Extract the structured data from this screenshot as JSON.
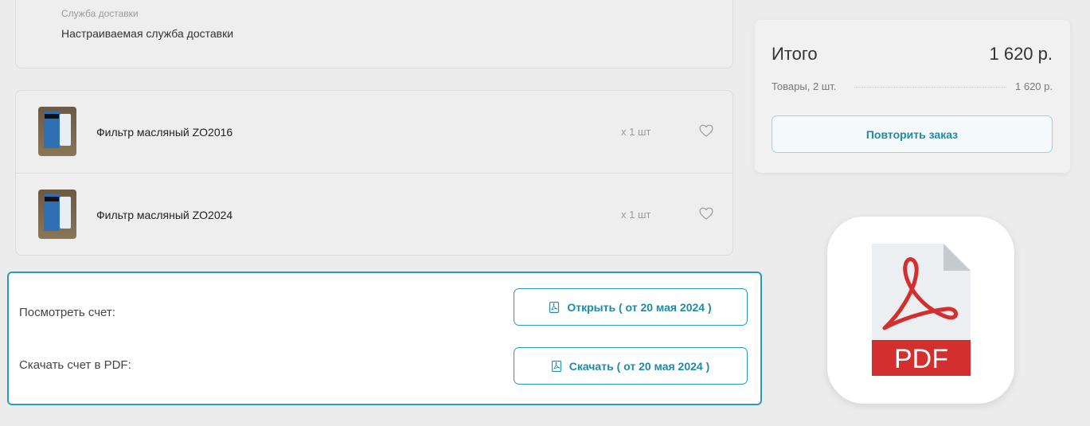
{
  "delivery": {
    "label": "Служба доставки",
    "value": "Настраиваемая служба доставки"
  },
  "items": [
    {
      "name": "Фильтр масляный ZO2016",
      "qty": "x 1 шт"
    },
    {
      "name": "Фильтр масляный ZO2024",
      "qty": "x 1 шт"
    }
  ],
  "invoice": {
    "view_label": "Посмотреть счет:",
    "open_button": "Открыть ( от 20 мая 2024 )",
    "download_label": "Скачать счет в PDF:",
    "download_button": "Скачать ( от 20 мая 2024 )"
  },
  "total": {
    "title": "Итого",
    "sum": "1 620 р.",
    "goods_label": "Товары, 2 шт.",
    "goods_sum": "1 620 р.",
    "repeat_button": "Повторить заказ"
  },
  "pdf_icon": {
    "text": "PDF",
    "icon": "pdf-file-icon"
  },
  "colors": {
    "accent": "#2a9ab8",
    "pdf_red": "#d32f2f"
  }
}
